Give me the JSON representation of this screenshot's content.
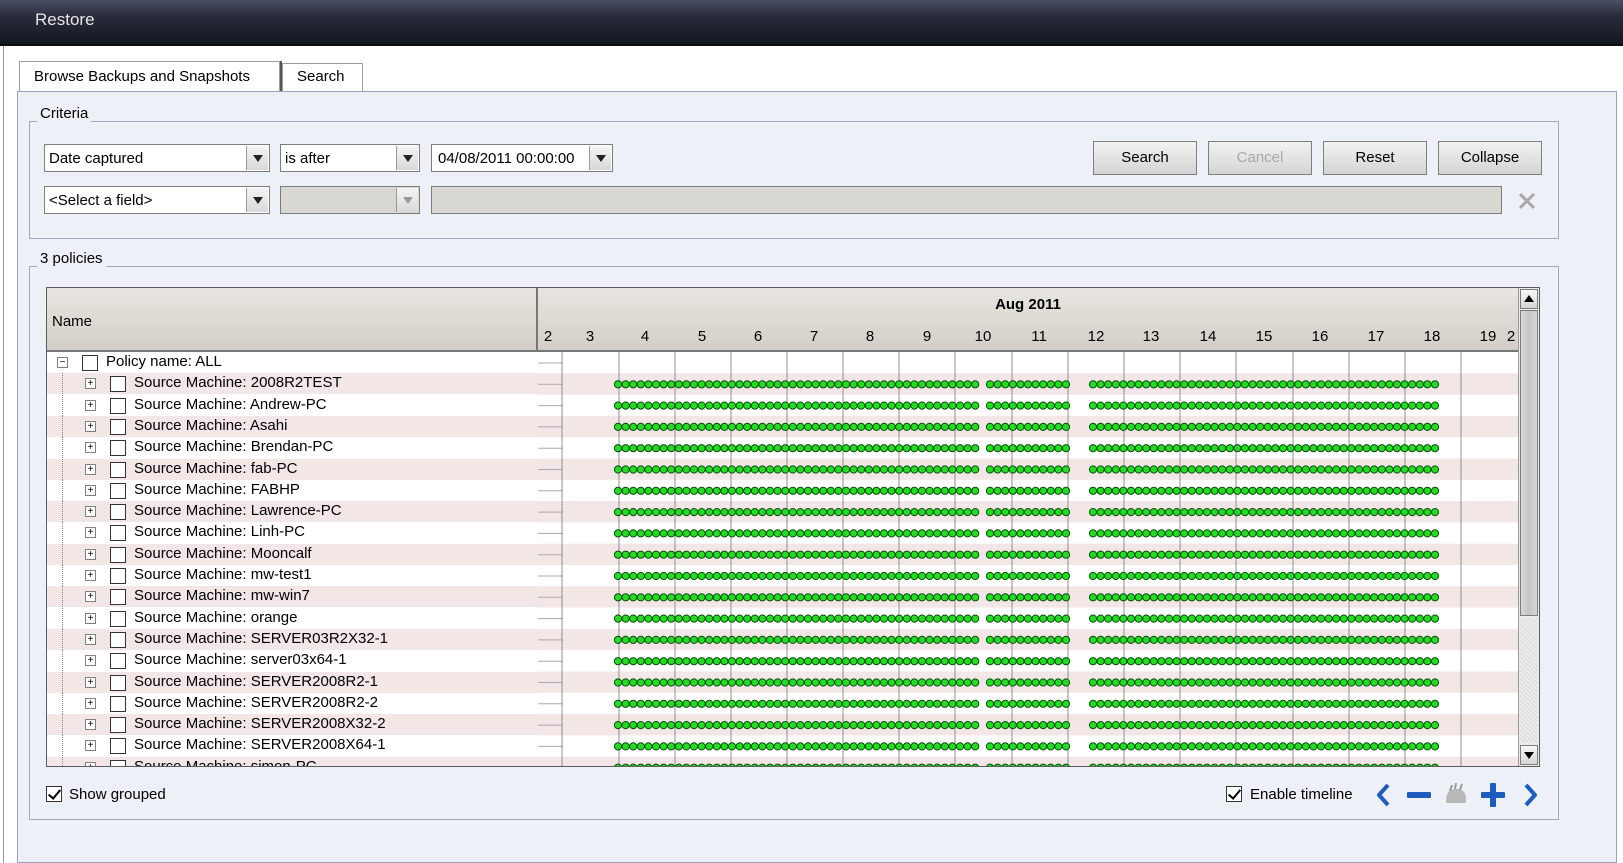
{
  "window": {
    "title": "Restore"
  },
  "tabs": [
    {
      "label": "Browse Backups and Snapshots",
      "active": true
    },
    {
      "label": "Search",
      "active": false
    }
  ],
  "criteria": {
    "legend": "Criteria",
    "row1": {
      "field": "Date captured",
      "operator": "is after",
      "value": "04/08/2011 00:00:00"
    },
    "row2": {
      "field": "<Select a field>",
      "operator": "",
      "value": ""
    },
    "buttons": {
      "search": "Search",
      "cancel": "Cancel",
      "reset": "Reset",
      "collapse": "Collapse"
    }
  },
  "policies": {
    "legend": "3 policies",
    "name_header": "Name",
    "month_label": "Aug 2011",
    "days": [
      "2",
      "3",
      "4",
      "5",
      "6",
      "7",
      "8",
      "9",
      "10",
      "11",
      "12",
      "13",
      "14",
      "15",
      "16",
      "17",
      "18",
      "19",
      "2"
    ],
    "root": {
      "label": "Policy name: ALL"
    },
    "machines": [
      {
        "label": "Source Machine: 2008R2TEST"
      },
      {
        "label": "Source Machine: Andrew-PC"
      },
      {
        "label": "Source Machine: Asahi"
      },
      {
        "label": "Source Machine: Brendan-PC"
      },
      {
        "label": "Source Machine: fab-PC"
      },
      {
        "label": "Source Machine: FABHP"
      },
      {
        "label": "Source Machine: Lawrence-PC"
      },
      {
        "label": "Source Machine: Linh-PC"
      },
      {
        "label": "Source Machine: Mooncalf"
      },
      {
        "label": "Source Machine: mw-test1"
      },
      {
        "label": "Source Machine: mw-win7"
      },
      {
        "label": "Source Machine: orange"
      },
      {
        "label": "Source Machine: SERVER03R2X32-1"
      },
      {
        "label": "Source Machine: server03x64-1"
      },
      {
        "label": "Source Machine: SERVER2008R2-1"
      },
      {
        "label": "Source Machine: SERVER2008R2-2"
      },
      {
        "label": "Source Machine: SERVER2008X32-2"
      },
      {
        "label": "Source Machine: SERVER2008X64-1"
      },
      {
        "label": "Source Machine: simon-PC"
      }
    ]
  },
  "footer": {
    "show_grouped": "Show grouped",
    "enable_timeline": "Enable timeline"
  },
  "colors": {
    "snapshot": "#22dd22",
    "accent": "#1e5bbf"
  },
  "icons": [
    "back-icon",
    "zoom-out-icon",
    "pan-icon",
    "zoom-in-icon",
    "forward-icon"
  ]
}
